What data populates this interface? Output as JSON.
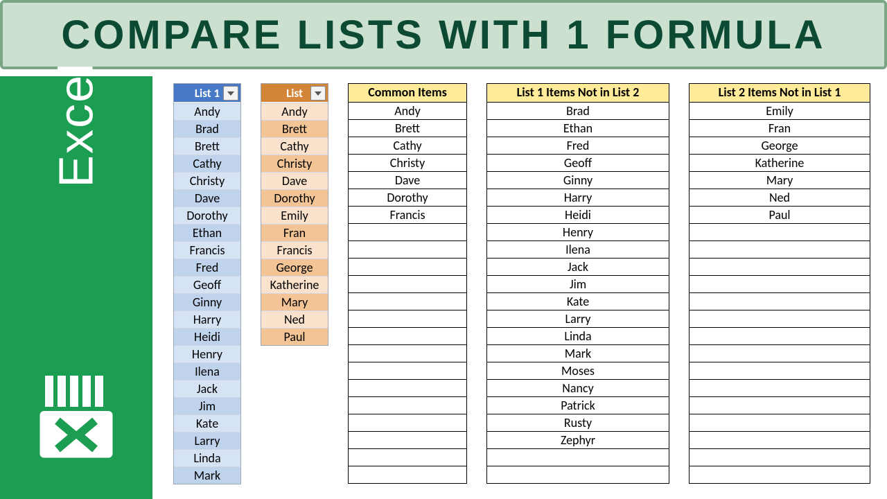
{
  "banner": {
    "title": "Compare Lists With 1 Formula"
  },
  "sidebar": {
    "label": "Excel"
  },
  "list1": {
    "header": "List 1",
    "items": [
      "Andy",
      "Brad",
      "Brett",
      "Cathy",
      "Christy",
      "Dave",
      "Dorothy",
      "Ethan",
      "Francis",
      "Fred",
      "Geoff",
      "Ginny",
      "Harry",
      "Heidi",
      "Henry",
      "Ilena",
      "Jack",
      "Jim",
      "Kate",
      "Larry",
      "Linda",
      "Mark"
    ]
  },
  "list2": {
    "header": "List",
    "items": [
      "Andy",
      "Brett",
      "Cathy",
      "Christy",
      "Dave",
      "Dorothy",
      "Emily",
      "Fran",
      "Francis",
      "George",
      "Katherine",
      "Mary",
      "Ned",
      "Paul"
    ]
  },
  "columns": {
    "common": {
      "header": "Common Items",
      "rows_total": 22,
      "items": [
        "Andy",
        "Brett",
        "Cathy",
        "Christy",
        "Dave",
        "Dorothy",
        "Francis"
      ]
    },
    "not12": {
      "header": "List 1 Items Not in List 2",
      "rows_total": 22,
      "items": [
        "Brad",
        "Ethan",
        "Fred",
        "Geoff",
        "Ginny",
        "Harry",
        "Heidi",
        "Henry",
        "Ilena",
        "Jack",
        "Jim",
        "Kate",
        "Larry",
        "Linda",
        "Mark",
        "Moses",
        "Nancy",
        "Patrick",
        "Rusty",
        "Zephyr"
      ]
    },
    "not21": {
      "header": "List 2 Items Not in List 1",
      "rows_total": 22,
      "items": [
        "Emily",
        "Fran",
        "George",
        "Katherine",
        "Mary",
        "Ned",
        "Paul"
      ]
    }
  }
}
